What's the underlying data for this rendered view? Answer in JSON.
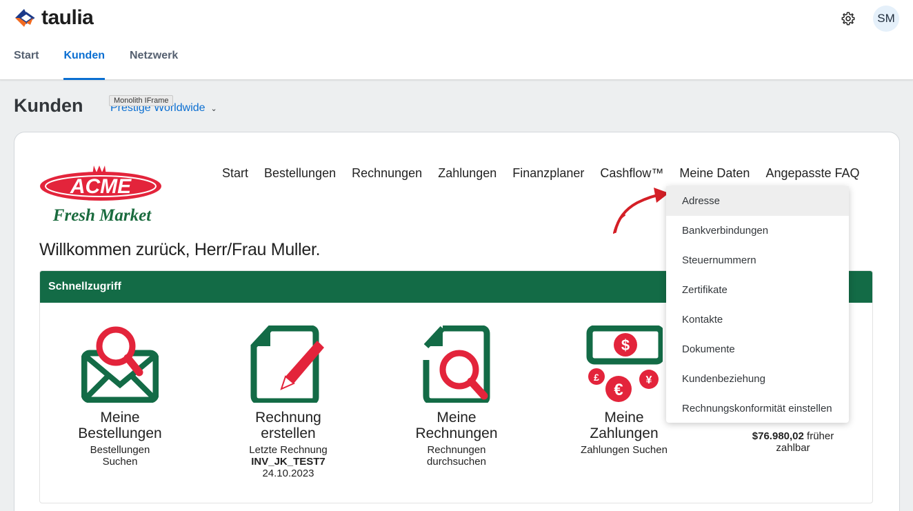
{
  "shell": {
    "brand": "taulia",
    "avatar_initials": "SM",
    "tabs": [
      "Start",
      "Kunden",
      "Netzwerk"
    ],
    "active_tab": "Kunden"
  },
  "page": {
    "title": "Kunden",
    "company_selector": "Prestige Worldwide",
    "tooltip": "Monolith IFrame"
  },
  "portal": {
    "logo_text_top": "ACME",
    "logo_text_bottom": "Fresh Market",
    "nav": [
      "Start",
      "Bestellungen",
      "Rechnungen",
      "Zahlungen",
      "Finanzplaner",
      "Cashflow™",
      "Meine Daten",
      "Angepasste FAQ"
    ],
    "welcome": "Willkommen zurück, Herr/Frau Muller.",
    "quick_access_title": "Schnellzugriff",
    "tiles": [
      {
        "title_1": "Meine",
        "title_2": "Bestellungen",
        "sub_1": "Bestellungen",
        "sub_2": "Suchen"
      },
      {
        "title_1": "Rechnung",
        "title_2": "erstellen",
        "sub_1": "Letzte Rechnung",
        "sub_2": "INV_JK_TEST7",
        "sub_3": "24.10.2023"
      },
      {
        "title_1": "Meine",
        "title_2": "Rechnungen",
        "sub_1": "Rechnungen",
        "sub_2": "durchsuchen"
      },
      {
        "title_1": "Meine",
        "title_2": "Zahlungen",
        "sub_1": "Zahlungen Suchen"
      },
      {
        "amount": "$76.980,02",
        "amount_suffix": "früher",
        "sub_2": "zahlbar"
      }
    ]
  },
  "menu": {
    "items": [
      "Adresse",
      "Bankverbindungen",
      "Steuernummern",
      "Zertifikate",
      "Kontakte",
      "Dokumente",
      "Kundenbeziehung",
      "Rechnungskonformität einstellen"
    ]
  },
  "colors": {
    "brand_green": "#136b46",
    "accent_red": "#e3243b",
    "link_blue": "#0a6ed1"
  },
  "icons": {
    "gear": "gear-icon",
    "arrow": "red-arrow-annotation"
  }
}
